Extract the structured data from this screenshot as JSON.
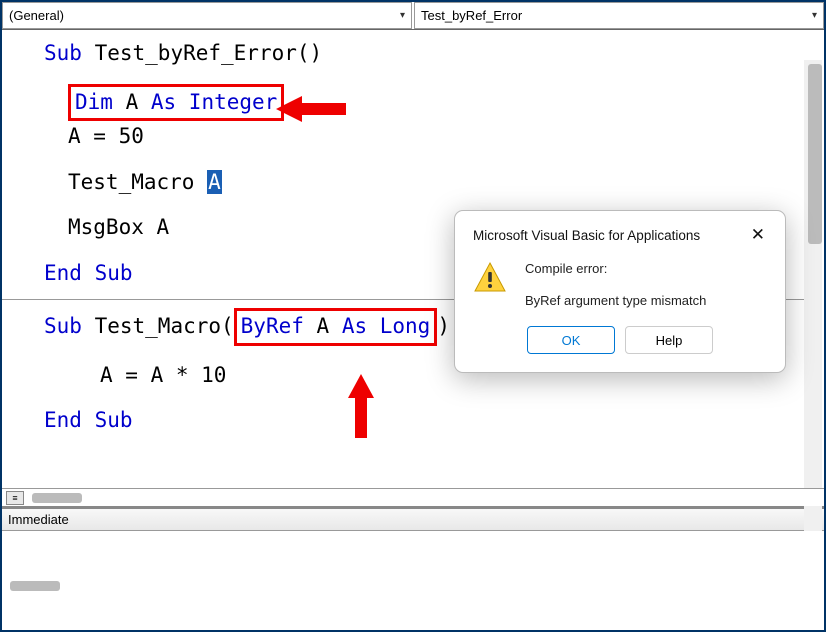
{
  "dropdowns": {
    "left": "(General)",
    "right": "Test_byRef_Error"
  },
  "code": {
    "sub1_kw": "Sub",
    "sub1_name": " Test_byRef_Error()",
    "dim_kw": "Dim",
    "dim_var": " A ",
    "as_kw": "As Integer",
    "assign": "A = 50",
    "call_name": "Test_Macro ",
    "call_arg": "A",
    "msgbox": "MsgBox A",
    "endsub": "End Sub",
    "sub2_kw": "Sub",
    "sub2_name": " Test_Macro(",
    "byref_kw": "ByRef",
    "byref_mid": " A ",
    "aslong_kw": "As Long",
    "sub2_close": ")",
    "body2": "A = A * 10"
  },
  "immediate": {
    "title": "Immediate"
  },
  "dialog": {
    "title": "Microsoft Visual Basic for Applications",
    "line1": "Compile error:",
    "line2": "ByRef argument type mismatch",
    "ok": "OK",
    "help": "Help"
  }
}
